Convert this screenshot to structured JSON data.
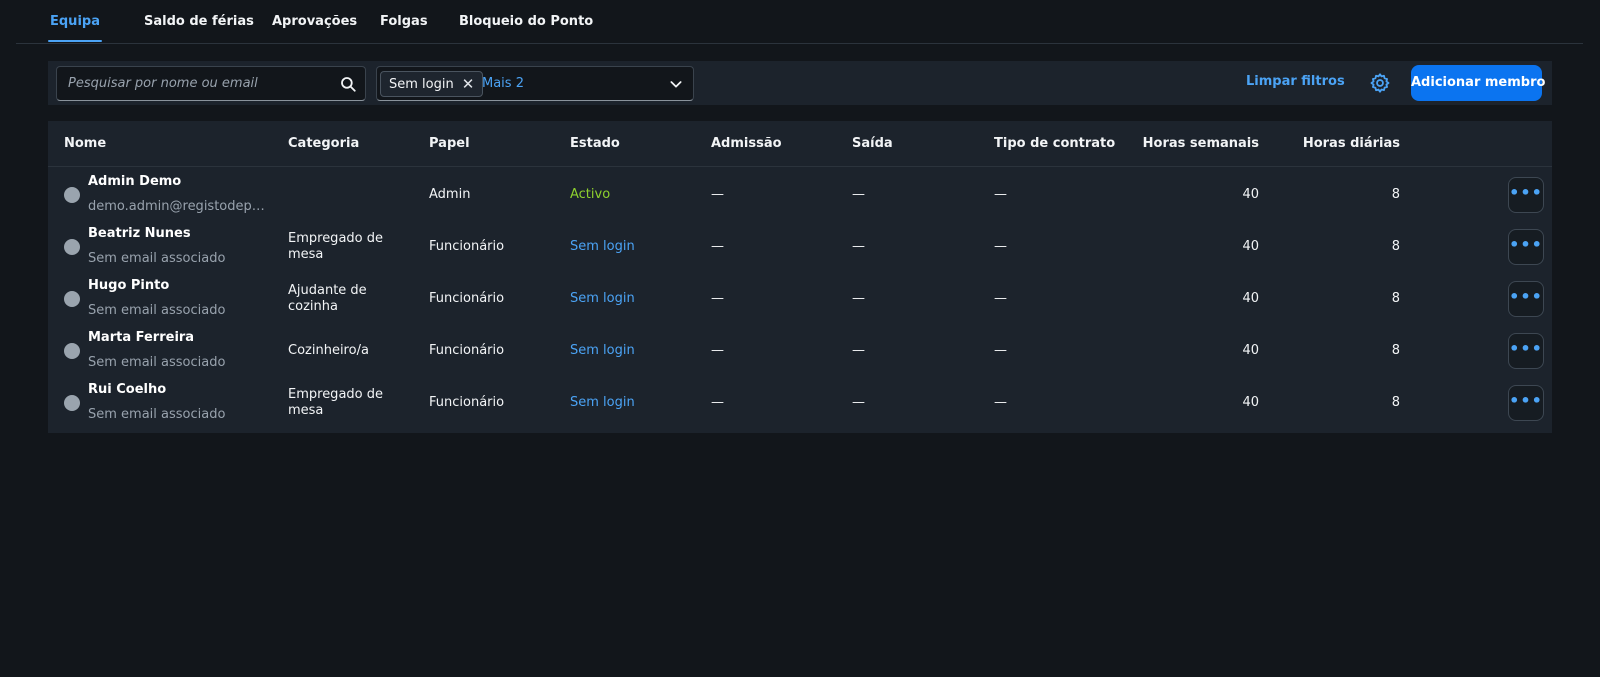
{
  "tabs": [
    {
      "label": "Equipa"
    },
    {
      "label": "Saldo de férias"
    },
    {
      "label": "Aprovações"
    },
    {
      "label": "Folgas"
    },
    {
      "label": "Bloqueio do Ponto"
    }
  ],
  "toolbar": {
    "search_placeholder": "Pesquisar por nome ou email",
    "search_icon": "search-icon",
    "filter_token": "Sem login",
    "filter_more": "Mais 2",
    "clear_filters": "Limpar filtros",
    "settings_icon": "gear-icon",
    "add_member": "Adicionar membro"
  },
  "table": {
    "headers": [
      "Nome",
      "Categoria",
      "Papel",
      "Estado",
      "Admissão",
      "Saída",
      "Tipo de contrato",
      "Horas semanais",
      "Horas diárias"
    ],
    "rows": [
      {
        "name": "Admin Demo",
        "email": "demo.admin@registodepon...",
        "category": "",
        "role": "Admin",
        "state": "Activo",
        "admission": "—",
        "exit": "—",
        "contract": "—",
        "weekly": "40",
        "daily": "8"
      },
      {
        "name": "Beatriz Nunes",
        "email": "Sem email associado",
        "category": "Empregado de mesa",
        "role": "Funcionário",
        "state": "Sem login",
        "admission": "—",
        "exit": "—",
        "contract": "—",
        "weekly": "40",
        "daily": "8"
      },
      {
        "name": "Hugo Pinto",
        "email": "Sem email associado",
        "category": "Ajudante de cozinha",
        "role": "Funcionário",
        "state": "Sem login",
        "admission": "—",
        "exit": "—",
        "contract": "—",
        "weekly": "40",
        "daily": "8"
      },
      {
        "name": "Marta Ferreira",
        "email": "Sem email associado",
        "category": "Cozinheiro/a",
        "role": "Funcionário",
        "state": "Sem login",
        "admission": "—",
        "exit": "—",
        "contract": "—",
        "weekly": "40",
        "daily": "8"
      },
      {
        "name": "Rui Coelho",
        "email": "Sem email associado",
        "category": "Empregado de mesa",
        "role": "Funcionário",
        "state": "Sem login",
        "admission": "—",
        "exit": "—",
        "contract": "—",
        "weekly": "40",
        "daily": "8"
      }
    ],
    "row_menu_label": "•••"
  },
  "colors": {
    "background": "#12161b",
    "panel": "#1c232c",
    "accent": "#4ba3f5",
    "primary_button": "#0b74f0",
    "active_state": "#8ed12e"
  }
}
